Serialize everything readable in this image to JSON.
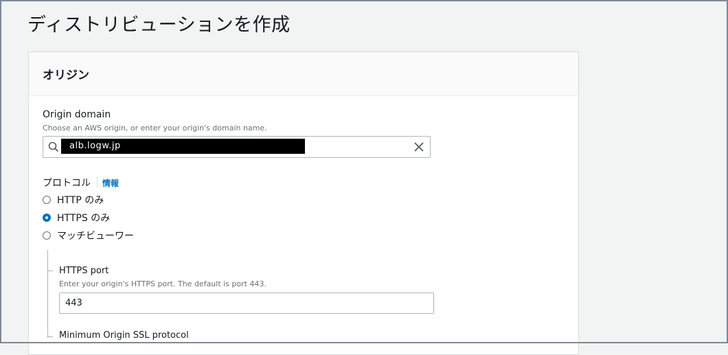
{
  "page": {
    "title": "ディストリビューションを作成"
  },
  "origin_panel": {
    "title": "オリジン",
    "origin_domain": {
      "label": "Origin domain",
      "description": "Choose an AWS origin, or enter your origin's domain name.",
      "value": "alb.logw.jp"
    },
    "protocol": {
      "label": "プロトコル",
      "info_link": "情報",
      "options": [
        "HTTP のみ",
        "HTTPS のみ",
        "マッチビューワー"
      ],
      "selected": "HTTPS のみ"
    },
    "https_port": {
      "label": "HTTPS port",
      "description": "Enter your origin's HTTPS port. The default is port 443.",
      "value": "443"
    },
    "min_ssl": {
      "label": "Minimum Origin SSL protocol"
    }
  },
  "colors": {
    "accent": "#0073bb",
    "border": "#aab7b8",
    "background": "#f2f3f3"
  }
}
